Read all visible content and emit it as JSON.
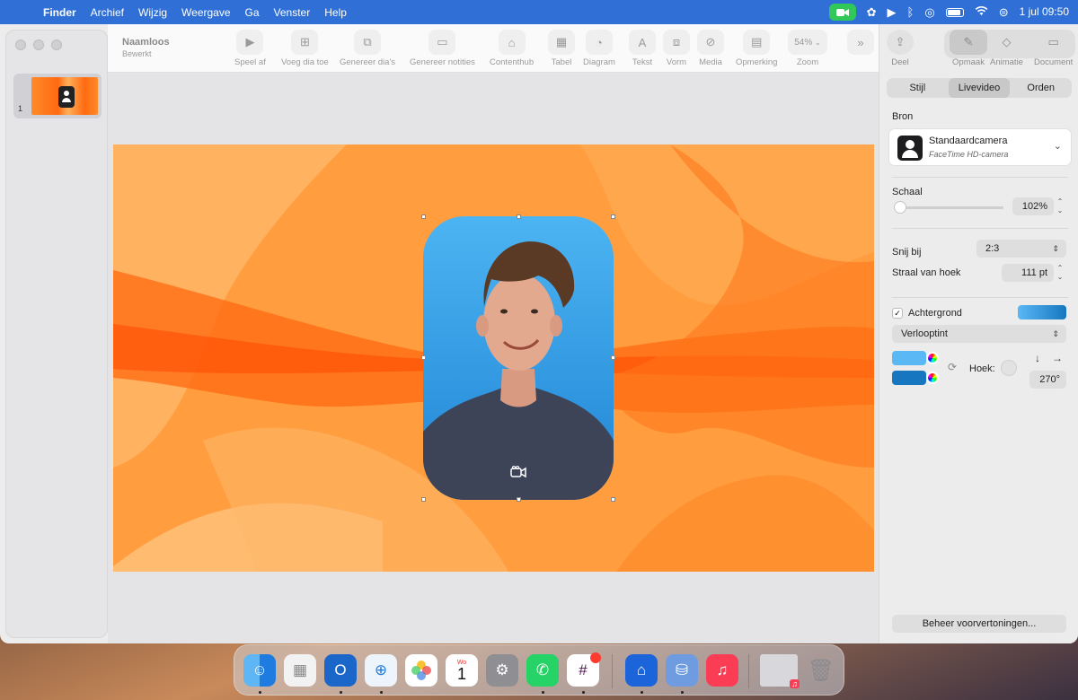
{
  "menubar": {
    "items": [
      "Finder",
      "Archief",
      "Wijzig",
      "Weergave",
      "Ga",
      "Venster",
      "Help"
    ],
    "clock": "1 jul  09:50"
  },
  "document": {
    "title": "Naamloos",
    "subtitle": "Bewerkt"
  },
  "toolbar": {
    "items": [
      {
        "label": "Speel af",
        "icon": "play-icon"
      },
      {
        "label": "Voeg dia toe",
        "icon": "add-slide-icon"
      },
      {
        "label": "Genereer dia's",
        "icon": "generate-slides-icon"
      },
      {
        "label": "Genereer notities",
        "icon": "generate-notes-icon"
      },
      {
        "label": "Contenthub",
        "icon": "content-hub-icon"
      },
      {
        "label": "Tabel",
        "icon": "table-icon"
      },
      {
        "label": "Diagram",
        "icon": "chart-icon"
      },
      {
        "label": "Tekst",
        "icon": "text-icon"
      },
      {
        "label": "Vorm",
        "icon": "shape-icon"
      },
      {
        "label": "Media",
        "icon": "media-icon"
      },
      {
        "label": "Opmerking",
        "icon": "comment-icon"
      },
      {
        "label": "Zoom",
        "icon": "zoom-icon",
        "value": "54%"
      }
    ]
  },
  "slides": [
    {
      "number": "1"
    }
  ],
  "panel": {
    "share_label": "Deel",
    "top_tabs": [
      "Opmaak",
      "Animatie",
      "Document"
    ],
    "sub_tabs": [
      "Stijl",
      "Livevideo",
      "Orden"
    ],
    "active_sub_tab": "Livevideo",
    "source_heading": "Bron",
    "source_name": "Standaardcamera",
    "source_device": "FaceTime HD-camera",
    "scale_label": "Schaal",
    "scale_value": "102%",
    "crop_label": "Snij bij",
    "crop_value": "2:3",
    "radius_label": "Straal van hoek",
    "radius_value": "111 pt",
    "background_label": "Achtergrond",
    "background_checked": true,
    "fill_type": "Verlooptint",
    "angle_label": "Hoek:",
    "angle_value": "270°",
    "manage_button": "Beheer voorvertoningen...",
    "colors": {
      "gradient_start": "#5ab8f5",
      "gradient_end": "#1677c0"
    }
  },
  "dock": {
    "apps": [
      "finder",
      "launchpad",
      "outlook",
      "safari",
      "photos",
      "calendar",
      "settings",
      "whatsapp",
      "slack",
      "keynote",
      "backup",
      "music",
      "music-player-window",
      "trash"
    ],
    "calendar_month": "Wo",
    "calendar_day": "1"
  }
}
